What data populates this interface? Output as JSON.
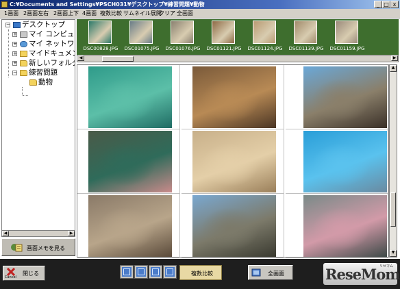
{
  "window": {
    "title": "C:¥Documents and Settings¥PSCH031¥デスクトップ¥練習問題¥動物",
    "controls": [
      "_",
      "□",
      "x"
    ]
  },
  "menu": {
    "items": [
      "1画面",
      "2画面左右",
      "2画面上下",
      "4画面",
      "複数比較",
      "サムネイル展開",
      "クリア",
      "全画面"
    ]
  },
  "tree": {
    "nodes": [
      {
        "label": "デスクトップ",
        "icon": "desktop-icon",
        "expander": "−"
      },
      {
        "label": "マイ コンピュー",
        "icon": "computer-icon",
        "expander": "+"
      },
      {
        "label": "マイ ネットワー",
        "icon": "network-icon",
        "expander": "+"
      },
      {
        "label": "マイドキュメン",
        "icon": "documents-icon",
        "expander": "+"
      },
      {
        "label": "新しいフォルダ",
        "icon": "folder-icon",
        "expander": "+"
      },
      {
        "label": "練習問題",
        "icon": "folder-icon",
        "expander": "−"
      },
      {
        "label": "動物",
        "icon": "folder-open-icon",
        "expander": ""
      }
    ]
  },
  "memo_button": {
    "label": "画面メモを見る"
  },
  "thumbnails": [
    {
      "filename": "DSC00828.JPG",
      "color": "#2e7a6a"
    },
    {
      "filename": "DSC01075.JPG",
      "color": "#6a7d88"
    },
    {
      "filename": "DSC01076.JPG",
      "color": "#8a8070"
    },
    {
      "filename": "DSC01121.JPG",
      "color": "#8e6a45"
    },
    {
      "filename": "DSC01124.JPG",
      "color": "#b89a72"
    },
    {
      "filename": "DSC01139.JPG",
      "color": "#a08a6a"
    },
    {
      "filename": "DSC01159.JPG",
      "color": "#9a8a7a"
    }
  ],
  "grid_photos": [
    {
      "subject": "shark-aquarium",
      "colors": [
        "#2f9b8a",
        "#5cbfa8",
        "#1f6b63"
      ]
    },
    {
      "subject": "lions-resting",
      "colors": [
        "#7a5a3a",
        "#b88a55",
        "#4a3524"
      ]
    },
    {
      "subject": "water-buffalo",
      "colors": [
        "#6aa8d8",
        "#8a7f6a",
        "#3a3028"
      ]
    },
    {
      "subject": "flamingo-pond",
      "colors": [
        "#4a5a48",
        "#2f6b5a",
        "#c98a8a"
      ]
    },
    {
      "subject": "meerkats",
      "colors": [
        "#c8b08a",
        "#e4cfa8",
        "#9a7f5a"
      ]
    },
    {
      "subject": "dolphin",
      "colors": [
        "#2a9ed8",
        "#5ac2ee",
        "#6a8aa0"
      ]
    },
    {
      "subject": "lion-behind-fence",
      "colors": [
        "#8a7a68",
        "#b8a58a",
        "#5a4a3a"
      ]
    },
    {
      "subject": "zebras",
      "colors": [
        "#7aa8d0",
        "#7c7a6a",
        "#3a3a30"
      ]
    },
    {
      "subject": "flamingos-rocks",
      "colors": [
        "#7a8a88",
        "#d29aa8",
        "#3e4a48"
      ]
    }
  ],
  "bottom": {
    "close_label": "閉じる",
    "close_sublabel": "Cancel",
    "compare_label": "複数比較",
    "fullscreen_label": "全画面",
    "logo_text": "ReseMom",
    "logo_small": "リセマム"
  }
}
